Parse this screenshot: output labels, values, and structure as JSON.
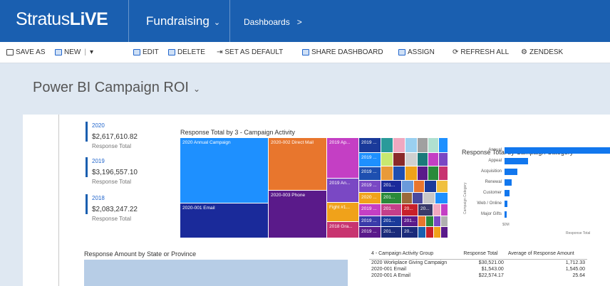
{
  "header": {
    "logo_prefix": "Stratus",
    "logo_brand": "LiVE",
    "area": "Fundraising",
    "breadcrumb": "Dashboards",
    "chevron": "⌄",
    "crumb_arrow": ">"
  },
  "commands": {
    "save_as": "SAVE AS",
    "new": "NEW",
    "edit": "EDIT",
    "delete": "DELETE",
    "set_default": "SET AS DEFAULT",
    "share": "SHARE DASHBOARD",
    "assign": "ASSIGN",
    "refresh": "REFRESH ALL",
    "zendesk": "ZENDESK",
    "divider": "|",
    "dropdown": "▾"
  },
  "page": {
    "title": "Power BI Campaign ROI",
    "chevron": "⌄"
  },
  "kpis": [
    {
      "year": "2020",
      "value": "$2,617,610.82",
      "label": "Response Total"
    },
    {
      "year": "2019",
      "value": "$3,196,557.10",
      "label": "Response Total"
    },
    {
      "year": "2018",
      "value": "$2,083,247.22",
      "label": "Response Total"
    }
  ],
  "treemap": {
    "title": "Response Total by 3 - Campaign Activity",
    "labels": {
      "annual": "2020 Annual Campaign",
      "direct_mail": "2020-002 Direct Mail",
      "ap": "2019 Ap...",
      "email": "2020-001 Email",
      "phone": "2020-003 Phone",
      "an": "2019 An...",
      "fight": "Fight #1...",
      "gra": "2018 Gra...",
      "s1": "2019 ...",
      "s2": "2019 ...",
      "s3": "2019 ...",
      "s4": "2019 ...",
      "s5": "2020 ...",
      "s6": "2019 ...",
      "s7": "2019 ...",
      "s8": "2019 ...",
      "t1": "201...",
      "t2": "201...",
      "t3": "201...",
      "t4": "201...",
      "t5": "201...",
      "t6": "201...",
      "u1": "20...",
      "u2": "20...",
      "u3": "20..."
    },
    "colors": {
      "annual": "#1e90ff",
      "direct_mail": "#e8762d",
      "ap": "#c43fc4",
      "email": "#1a2a9a",
      "phone": "#5a1a8a",
      "an": "#7a48c4",
      "fight": "#f0a21a",
      "gra": "#c83470"
    }
  },
  "category_chart": {
    "title": "Response Total by Campaign Category",
    "y_axis_label": "Campaign Category",
    "x_axis_label": "Response Total",
    "x_tick": "$0M",
    "categories": [
      "Annual",
      "Appeal",
      "Acquisition",
      "Renewal",
      "Customer",
      "Web / Online",
      "Major Gifts"
    ],
    "values": [
      100,
      22,
      12,
      7,
      5,
      3,
      2
    ]
  },
  "map": {
    "title": "Response Amount by State or Province"
  },
  "table": {
    "headers": [
      "4 - Campaign Activity Group",
      "Response Total",
      "Average of Response Amount"
    ],
    "rows": [
      [
        "2020 Workplace Giving Campaign",
        "$30,521.00",
        "1,712.33"
      ],
      [
        "2020-001 Email",
        "$1,543.00",
        "1,545.00"
      ],
      [
        "2020-001 A Email",
        "$22,574.17",
        "25.64"
      ]
    ]
  }
}
